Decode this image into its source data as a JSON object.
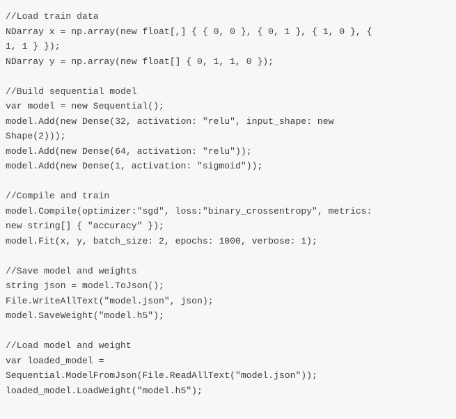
{
  "code": {
    "lines": [
      "//Load train data",
      "NDarray x = np.array(new float[,] { { 0, 0 }, { 0, 1 }, { 1, 0 }, {",
      "1, 1 } });",
      "NDarray y = np.array(new float[] { 0, 1, 1, 0 });",
      "",
      "//Build sequential model",
      "var model = new Sequential();",
      "model.Add(new Dense(32, activation: \"relu\", input_shape: new",
      "Shape(2)));",
      "model.Add(new Dense(64, activation: \"relu\"));",
      "model.Add(new Dense(1, activation: \"sigmoid\"));",
      "",
      "//Compile and train",
      "model.Compile(optimizer:\"sgd\", loss:\"binary_crossentropy\", metrics:",
      "new string[] { \"accuracy\" });",
      "model.Fit(x, y, batch_size: 2, epochs: 1000, verbose: 1);",
      "",
      "//Save model and weights",
      "string json = model.ToJson();",
      "File.WriteAllText(\"model.json\", json);",
      "model.SaveWeight(\"model.h5\");",
      "",
      "//Load model and weight",
      "var loaded_model =",
      "Sequential.ModelFromJson(File.ReadAllText(\"model.json\"));",
      "loaded_model.LoadWeight(\"model.h5\");"
    ]
  }
}
